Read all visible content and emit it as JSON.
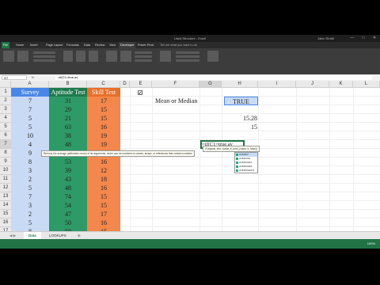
{
  "window": {
    "title": "Used Structure - Excel",
    "user": "Jalen Smith",
    "tabs": [
      "File",
      "Home",
      "Insert",
      "Page Layout",
      "Formulas",
      "Data",
      "Review",
      "View",
      "Developer",
      "Power Pivot",
      "Tell me what you want to do"
    ]
  },
  "formula_bar": {
    "name_box": "G7",
    "fx": "fx",
    "formula": "=if(C1=true,av"
  },
  "columns": [
    "A",
    "B",
    "C",
    "D",
    "E",
    "F",
    "G",
    "H",
    "I",
    "J",
    "K",
    "L"
  ],
  "rows": [
    "1",
    "2",
    "3",
    "4",
    "5",
    "6",
    "7",
    "8",
    "9",
    "10",
    "11",
    "12",
    "13",
    "14",
    "15",
    "16",
    "17",
    "18",
    "19"
  ],
  "table": {
    "headers": [
      "Survey",
      "Aptitude Test",
      "Skill Test"
    ],
    "survey": [
      "7",
      "7",
      "5",
      "5",
      "10",
      "4",
      "9",
      "8",
      "3",
      "2",
      "5",
      "7",
      "3",
      "2",
      "5",
      "8"
    ],
    "aptitude": [
      "31",
      "29",
      "21",
      "63",
      "38",
      "48",
      "71",
      "53",
      "39",
      "43",
      "48",
      "74",
      "54",
      "47",
      "50",
      "50",
      "50"
    ],
    "skill": [
      "17",
      "15",
      "15",
      "16",
      "19",
      "19",
      "17",
      "16",
      "12",
      "18",
      "16",
      "15",
      "15",
      "17",
      "16",
      "15",
      "15"
    ]
  },
  "control": {
    "checkbox_mark": "✔",
    "label": "Mean or Median",
    "value": "TRUE",
    "result1": "15.28",
    "result2": "15",
    "editing": "=if(C1=true,av"
  },
  "tooltip": {
    "signature": "IF(logical_test, [value_if_true], [value_if_false])",
    "description": "Returns the average (arithmetic mean) of its arguments, which can be numbers or names, arrays, or references that contain numbers"
  },
  "autocomplete": [
    "AVEDEV",
    "AVERAGE",
    "AVERAGEA",
    "AVERAGEIF",
    "AVERAGEIFS"
  ],
  "sheets": [
    "Data",
    "LOOKUPS"
  ],
  "status": {
    "zoom": "100%"
  },
  "colors": {
    "survey": "#c9daf4",
    "aptitude": "#2e9a67",
    "skill": "#f4874b",
    "control_cell": "#c9daf4",
    "excel_green": "#217346"
  }
}
